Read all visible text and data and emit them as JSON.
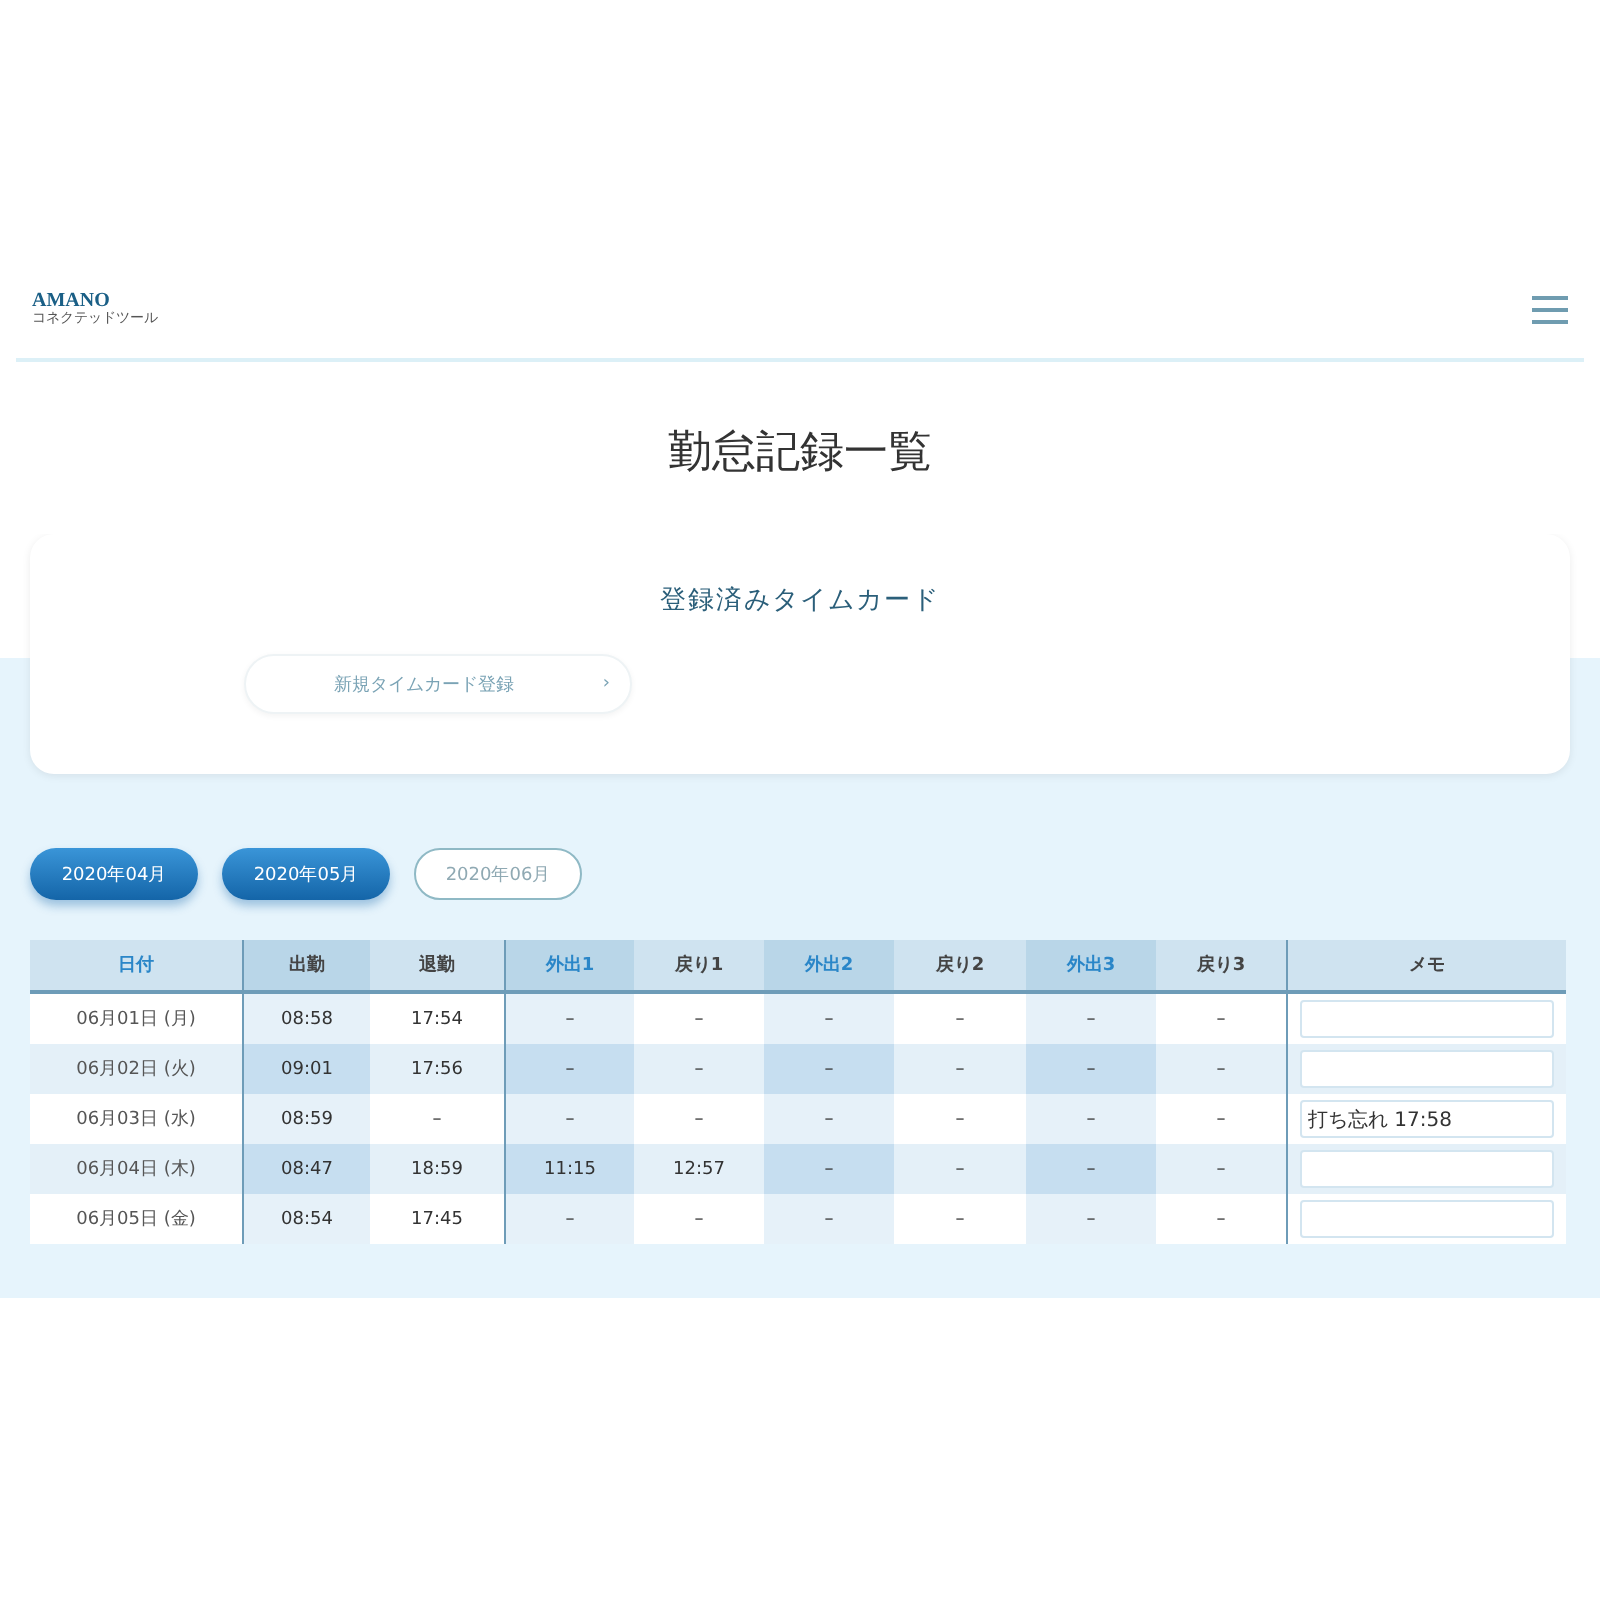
{
  "header": {
    "logo": "AMANO",
    "logo_sub": "コネクテッドツール"
  },
  "title": "勤怠記録一覧",
  "card": {
    "title": "登録済みタイムカード",
    "link": {
      "label": "新規タイムカード登録",
      "arrow": "›"
    }
  },
  "months": [
    {
      "label": "2020年04月",
      "selected": false
    },
    {
      "label": "2020年05月",
      "selected": false
    },
    {
      "label": "2020年06月",
      "selected": true
    }
  ],
  "table": {
    "columns": [
      "日付",
      "出勤",
      "退勤",
      "外出1",
      "戻り1",
      "外出2",
      "戻り2",
      "外出3",
      "戻り3",
      "メモ"
    ],
    "rows": [
      {
        "cells": [
          "06月01日 (月)",
          "08:58",
          "17:54",
          "–",
          "–",
          "–",
          "–",
          "–",
          "–"
        ]
      },
      {
        "cells": [
          "06月02日 (火)",
          "09:01",
          "17:56",
          "–",
          "–",
          "–",
          "–",
          "–",
          "–"
        ]
      },
      {
        "cells": [
          "06月03日 (水)",
          "08:59",
          "–",
          "–",
          "–",
          "–",
          "–",
          "–",
          "–",
          "打ち忘れ 17:58"
        ]
      },
      {
        "cells": [
          "06月04日 (木)",
          "08:47",
          "18:59",
          "11:15",
          "12:57",
          "–",
          "–",
          "–",
          "–"
        ]
      },
      {
        "cells": [
          "06月05日 (金)",
          "08:54",
          "17:45",
          "–",
          "–",
          "–",
          "–",
          "–",
          "–"
        ]
      }
    ]
  }
}
